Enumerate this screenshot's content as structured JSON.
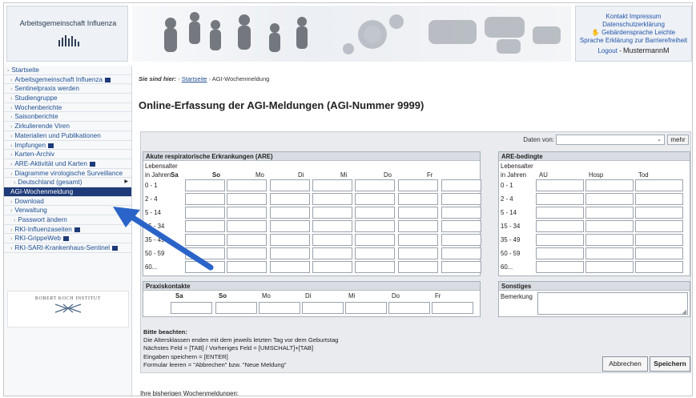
{
  "header": {
    "org_title": "Arbeitsgemeinschaft Influenza",
    "links_line1": "Kontakt  Impressum",
    "links_line2": "Datenschutzerklärung",
    "links_line3": "Gebärdensprache  Leichte",
    "links_line4": "Sprache Erklärung zur Barrierefreiheit",
    "logout": "Logout",
    "separator": " - ",
    "user": "MustermannM"
  },
  "sidebar": {
    "items": [
      {
        "label": "Startseite"
      },
      {
        "label": "Arbeitsgemeinschaft Influenza"
      },
      {
        "label": "Sentinelpraxis werden"
      },
      {
        "label": "Studiengruppe"
      },
      {
        "label": "Wochenberichte"
      },
      {
        "label": "Saisonberichte"
      },
      {
        "label": "Zirkulierende Viren"
      },
      {
        "label": "Materialien und Publikationen"
      },
      {
        "label": "Impfungen"
      },
      {
        "label": "Karten-Archiv"
      },
      {
        "label": "ARE-Aktivität und Karten"
      },
      {
        "label": "Diagramme virologische Surveillance"
      },
      {
        "label": "Deutschland (gesamt)"
      },
      {
        "label": "AGI-Wochenmeldung"
      },
      {
        "label": "Download"
      },
      {
        "label": "Verwaltung"
      },
      {
        "label": "Passwort ändern"
      },
      {
        "label": "RKI-Influenzaseiten"
      },
      {
        "label": "RKI-GrippeWeb"
      },
      {
        "label": "RKI-SARI-Krankenhaus-Sentinel"
      }
    ],
    "rki_name": "ROBERT KOCH INSTITUT"
  },
  "main": {
    "breadcrumb_prefix": "Sie sind hier:",
    "breadcrumb_home": "Startseite",
    "breadcrumb_current": "AGI-Wochenmeldung",
    "page_title": "Online-Erfassung der AGI-Meldungen (AGI-Nummer 9999)",
    "daten_label": "Daten von:",
    "daten_value": "",
    "mehr_label": "mehr",
    "are": {
      "title": "Akute respiratorische Erkrankungen (ARE)",
      "col_label1": "Lebensalter",
      "col_label2": "in Jahren",
      "days": [
        "Sa",
        "So",
        "Mo",
        "Di",
        "Mi",
        "Do",
        "Fr"
      ],
      "ages": [
        "0 - 1",
        "2 - 4",
        "5 - 14",
        "15 - 34",
        "35 - 49",
        "50 - 59",
        "60..."
      ]
    },
    "are_based": {
      "title": "ARE-bedingte",
      "col_label1": "Lebensalter",
      "col_label2": "in Jahren",
      "cols": [
        "AU",
        "Hosp",
        "Tod"
      ],
      "ages": [
        "0 - 1",
        "2 - 4",
        "5 - 14",
        "15 - 34",
        "35 - 49",
        "50 - 59",
        "60..."
      ]
    },
    "praxis": {
      "title": "Praxiskontakte",
      "days": [
        "Sa",
        "So",
        "Mo",
        "Di",
        "Mi",
        "Do",
        "Fr"
      ]
    },
    "sonstiges": {
      "title": "Sonstiges",
      "bemerkung": "Bemerkung"
    },
    "hinweis": {
      "title": "Bitte beachten:",
      "line1": "Die Altersklassen enden mit dem jeweils letzten Tag vor dem Geburtstag",
      "line2": "Nächstes Feld = [TAB] / Vorheriges Feld = [UMSCHALT]+[TAB]",
      "line3": "Eingaben speichern = [ENTER]",
      "line4": "Formular leeren = \"Abbrechen\" bzw. \"Neue Meldung\""
    },
    "cancel_label": "Abbrechen",
    "save_label": "Speichern",
    "history_label": "Ihre bisherigen Wochenmeldungen:"
  },
  "colors": {
    "nav_active_bg": "#1e3a78",
    "link": "#1d4f91",
    "annotation_arrow": "#2a64c8"
  }
}
